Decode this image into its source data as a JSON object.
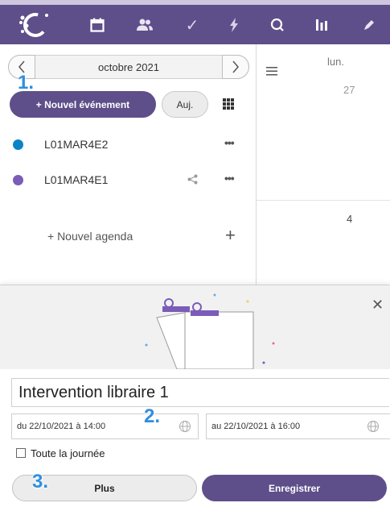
{
  "colors": {
    "brand": "#5e4f8a",
    "agenda1": "#0a84c6",
    "agenda2": "#7b5cb8",
    "step": "#2f8fe0"
  },
  "topbar": {
    "icons": [
      "calendar-icon",
      "users-icon",
      "check-icon",
      "lightning-icon",
      "search-icon",
      "stats-icon",
      "pencil-icon"
    ]
  },
  "calendar": {
    "month_label": "octobre 2021",
    "new_event_label": "+ Nouvel événement",
    "today_label": "Auj.",
    "agendas": [
      {
        "name": "L01MAR4E2",
        "color": "#0a84c6"
      },
      {
        "name": "L01MAR4E1",
        "color": "#7b5cb8"
      }
    ],
    "new_agenda_label": "+ Nouvel agenda",
    "week_day": "lun.",
    "dates": [
      "27",
      "4"
    ]
  },
  "event_form": {
    "title_value": "Intervention libraire 1",
    "start_value": "du 22/10/2021 à 14:00",
    "end_value": "au 22/10/2021 à 16:00",
    "all_day_label": "Toute la journée",
    "all_day_checked": false,
    "more_label": "Plus",
    "save_label": "Enregistrer"
  },
  "annotations": [
    "1.",
    "2.",
    "3."
  ]
}
